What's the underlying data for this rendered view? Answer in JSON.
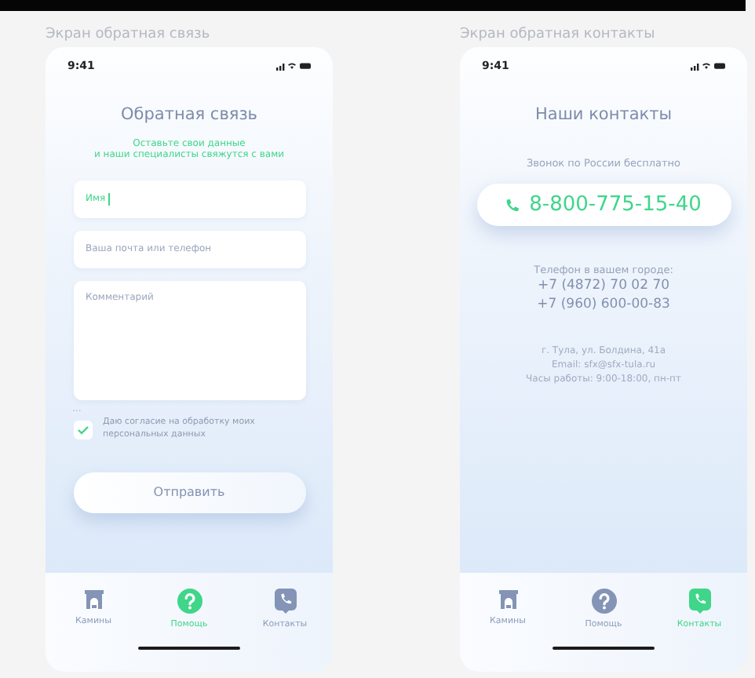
{
  "screens": [
    {
      "kind": "feedback",
      "caption": "Экран обратная связь",
      "time": "9:41",
      "title": "Обратная связь",
      "subtitle": "Оставьте свои данные\nи наши специалисты свяжутся с вами",
      "fields": [
        {
          "kind": "input",
          "placeholder": "Имя",
          "focused": true
        },
        {
          "kind": "input",
          "placeholder": "Ваша почта или телефон",
          "focused": false
        },
        {
          "kind": "textarea",
          "placeholder": "Комментарий",
          "focused": false
        }
      ],
      "ellipsis": "...",
      "consent": {
        "checked": true,
        "text": "Даю согласие на обработку моих персональных данных"
      },
      "submit": "Отправить",
      "tabs": [
        {
          "label": "Камины",
          "selected": false
        },
        {
          "label": "Помощь",
          "selected": true
        },
        {
          "label": "Контакты",
          "selected": false
        }
      ]
    },
    {
      "kind": "contacts",
      "caption": "Экран обратная контакты",
      "time": "9:41",
      "title": "Наши контакты",
      "free_call_note": "Звонок по России бесплатно",
      "hotline": "8-800-775-15-40",
      "city_phones_label": "Телефон в вашем городе:",
      "city_phones": [
        "+7 (4872) 70 02 70",
        "+7 (960) 600-00-83"
      ],
      "info_lines": [
        "г. Тула, ул. Болдина, 41а",
        "Email: sfx@sfx-tula.ru",
        "Часы работы: 9:00-18:00, пн-пт"
      ],
      "tabs": [
        {
          "label": "Камины",
          "selected": false
        },
        {
          "label": "Помощь",
          "selected": false
        },
        {
          "label": "Контакты",
          "selected": true
        }
      ]
    }
  ]
}
